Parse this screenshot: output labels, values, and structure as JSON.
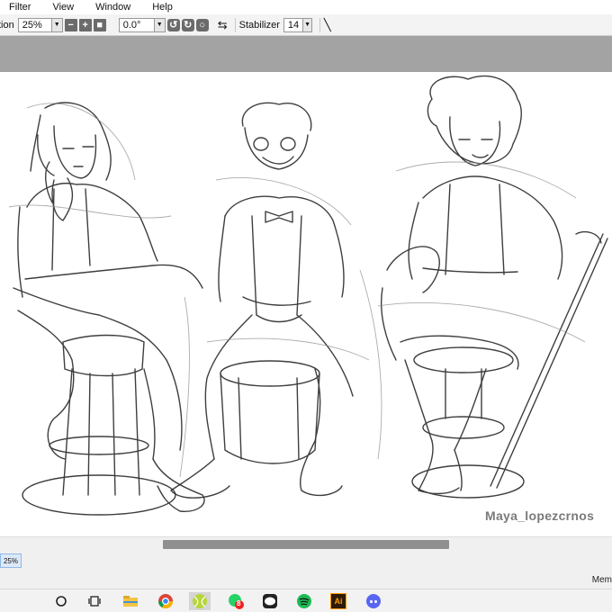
{
  "menu": {
    "filter": "Filter",
    "view": "View",
    "window": "Window",
    "help": "Help"
  },
  "toolbar": {
    "partial_label": "tion",
    "zoom_value": "25%",
    "rotation_value": "0.0°",
    "stabilizer_label": "Stabilizer",
    "stabilizer_value": "14"
  },
  "canvas": {
    "watermark": "Maya_lopezcrnos"
  },
  "status": {
    "zoom_badge": "25%",
    "memory_label": "Mem"
  },
  "icons": {
    "zoom_out": "minus-icon",
    "zoom_in": "plus-icon",
    "zoom_reset": "reset-icon",
    "rotate_left": "rotate-left-icon",
    "rotate_right": "rotate-right-icon",
    "rotate_reset": "rotate-reset-icon",
    "flip": "flip-horizontal-icon",
    "stroke": "stroke-diagonal-icon"
  },
  "taskbar": {
    "items": [
      "cortana-circle-icon",
      "task-view-icon",
      "file-explorer-icon",
      "chrome-icon",
      "tennis-app-icon",
      "whatsapp-icon",
      "line-icon",
      "spotify-icon",
      "illustrator-icon",
      "discord-icon"
    ],
    "whatsapp_badge": "8",
    "illustrator_label": "Ai"
  },
  "colors": {
    "grey_bar": "#a3a3a3",
    "scroll_thumb": "#8f8f8f",
    "ai_orange": "#ff9a00",
    "spotify_green": "#1db954",
    "discord_blurple": "#5865f2",
    "whatsapp_green": "#25d366"
  }
}
